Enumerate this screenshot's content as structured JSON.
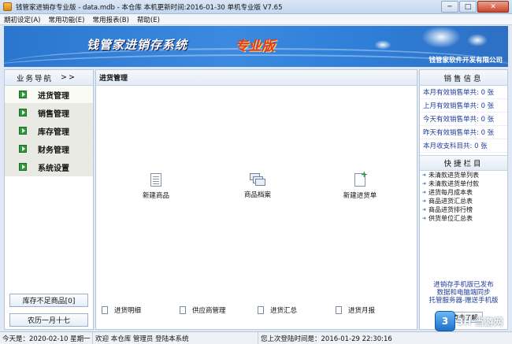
{
  "window": {
    "title": "钱管家进销存专业版 - data.mdb - 本仓库  本机更新时间:2016-01-30 单机专业版 V7.65",
    "buttons": {
      "minimize": "─",
      "maximize": "□",
      "close": "✕"
    }
  },
  "menu": [
    "期初设定(A)",
    "常用功能(E)",
    "常用报表(B)",
    "帮助(E)"
  ],
  "banner": {
    "brand": "钱管家进销存系统",
    "edition": "专业版",
    "company": "钱管家软件开发有限公司"
  },
  "sidebar": {
    "header": "业务导航",
    "collapse": ">>",
    "items": [
      {
        "label": "进货管理",
        "active": true
      },
      {
        "label": "销售管理",
        "active": false
      },
      {
        "label": "库存管理",
        "active": false
      },
      {
        "label": "财务管理",
        "active": false
      },
      {
        "label": "系统设置",
        "active": false
      }
    ],
    "low_stock": "库存不足商品[0]",
    "lunar": "农历一月十七"
  },
  "main": {
    "title": "进货管理",
    "tools": [
      {
        "label": "新建商品",
        "icon": "document-icon"
      },
      {
        "label": "商品档案",
        "icon": "folder-icon"
      },
      {
        "label": "新建进货单",
        "icon": "new-document-icon"
      }
    ],
    "bottom_tools": [
      "进货明细",
      "供应商管理",
      "进货汇总",
      "进货月报"
    ]
  },
  "sales_info": {
    "header": "销售信息",
    "rows": [
      "本月有效销售单共: 0 张",
      "上月有效销售单共: 0 张",
      "今天有效销售单共: 0 张",
      "昨天有效销售单共: 0 张",
      "本月收支科目共: 0 张"
    ]
  },
  "quick": {
    "header": "快捷栏目",
    "links": [
      "未清款进货单列表",
      "未清款进货单付款",
      "进货每月成本表",
      "商品进货汇总表",
      "商品进货排行榜",
      "供货单位汇总表"
    ]
  },
  "promo": {
    "lines": [
      "进销存手机版已发布",
      "数据和电脑端同步",
      "托管服务器-赠送手机版"
    ],
    "button": "点击了解"
  },
  "watermark": {
    "logo": "3",
    "text": "3H 当游网"
  },
  "status": {
    "date": "今天是：2020-02-10  星期一",
    "welcome": "欢迎 本仓库 管理员  登陆本系统",
    "last_login": "您上次登陆时间是：2016-01-29 22:30:16"
  },
  "colors": {
    "banner": "#2f7fd9",
    "accent_text": "#1e3d9a",
    "edition": "#e63a1e",
    "nav_arrow": "#2e9b3b"
  }
}
